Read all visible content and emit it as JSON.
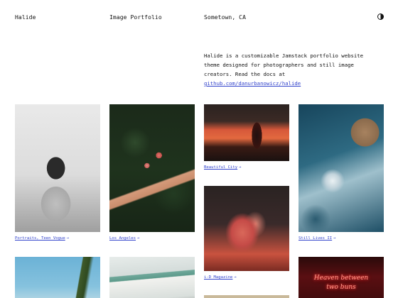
{
  "header": {
    "site_title": "Halide",
    "subtitle": "Image Portfolio",
    "location": "Sometown, CA",
    "theme_toggle_icon": "half-circle-icon"
  },
  "intro": {
    "text": "Halide is a customizable Jamstack portfolio website theme designed for photographers and still image creators. Read the docs at ",
    "link_text": "github.com/danurbanowicz/halide"
  },
  "gallery": {
    "arrow": "→",
    "items": [
      {
        "caption": "Portraits, Teen Vogue"
      },
      {
        "caption": "Los Angeles"
      },
      {
        "caption": "Beautiful City"
      },
      {
        "caption": "Still Lives II"
      },
      {
        "caption": "i-D Magazine"
      },
      {
        "caption": ""
      },
      {
        "caption": ""
      },
      {
        "caption": ""
      }
    ],
    "neon_text_line1": "Heaven between",
    "neon_text_line2": "two buns"
  },
  "colors": {
    "text": "#111111",
    "link": "#3344cc",
    "background": "#ffffff"
  }
}
